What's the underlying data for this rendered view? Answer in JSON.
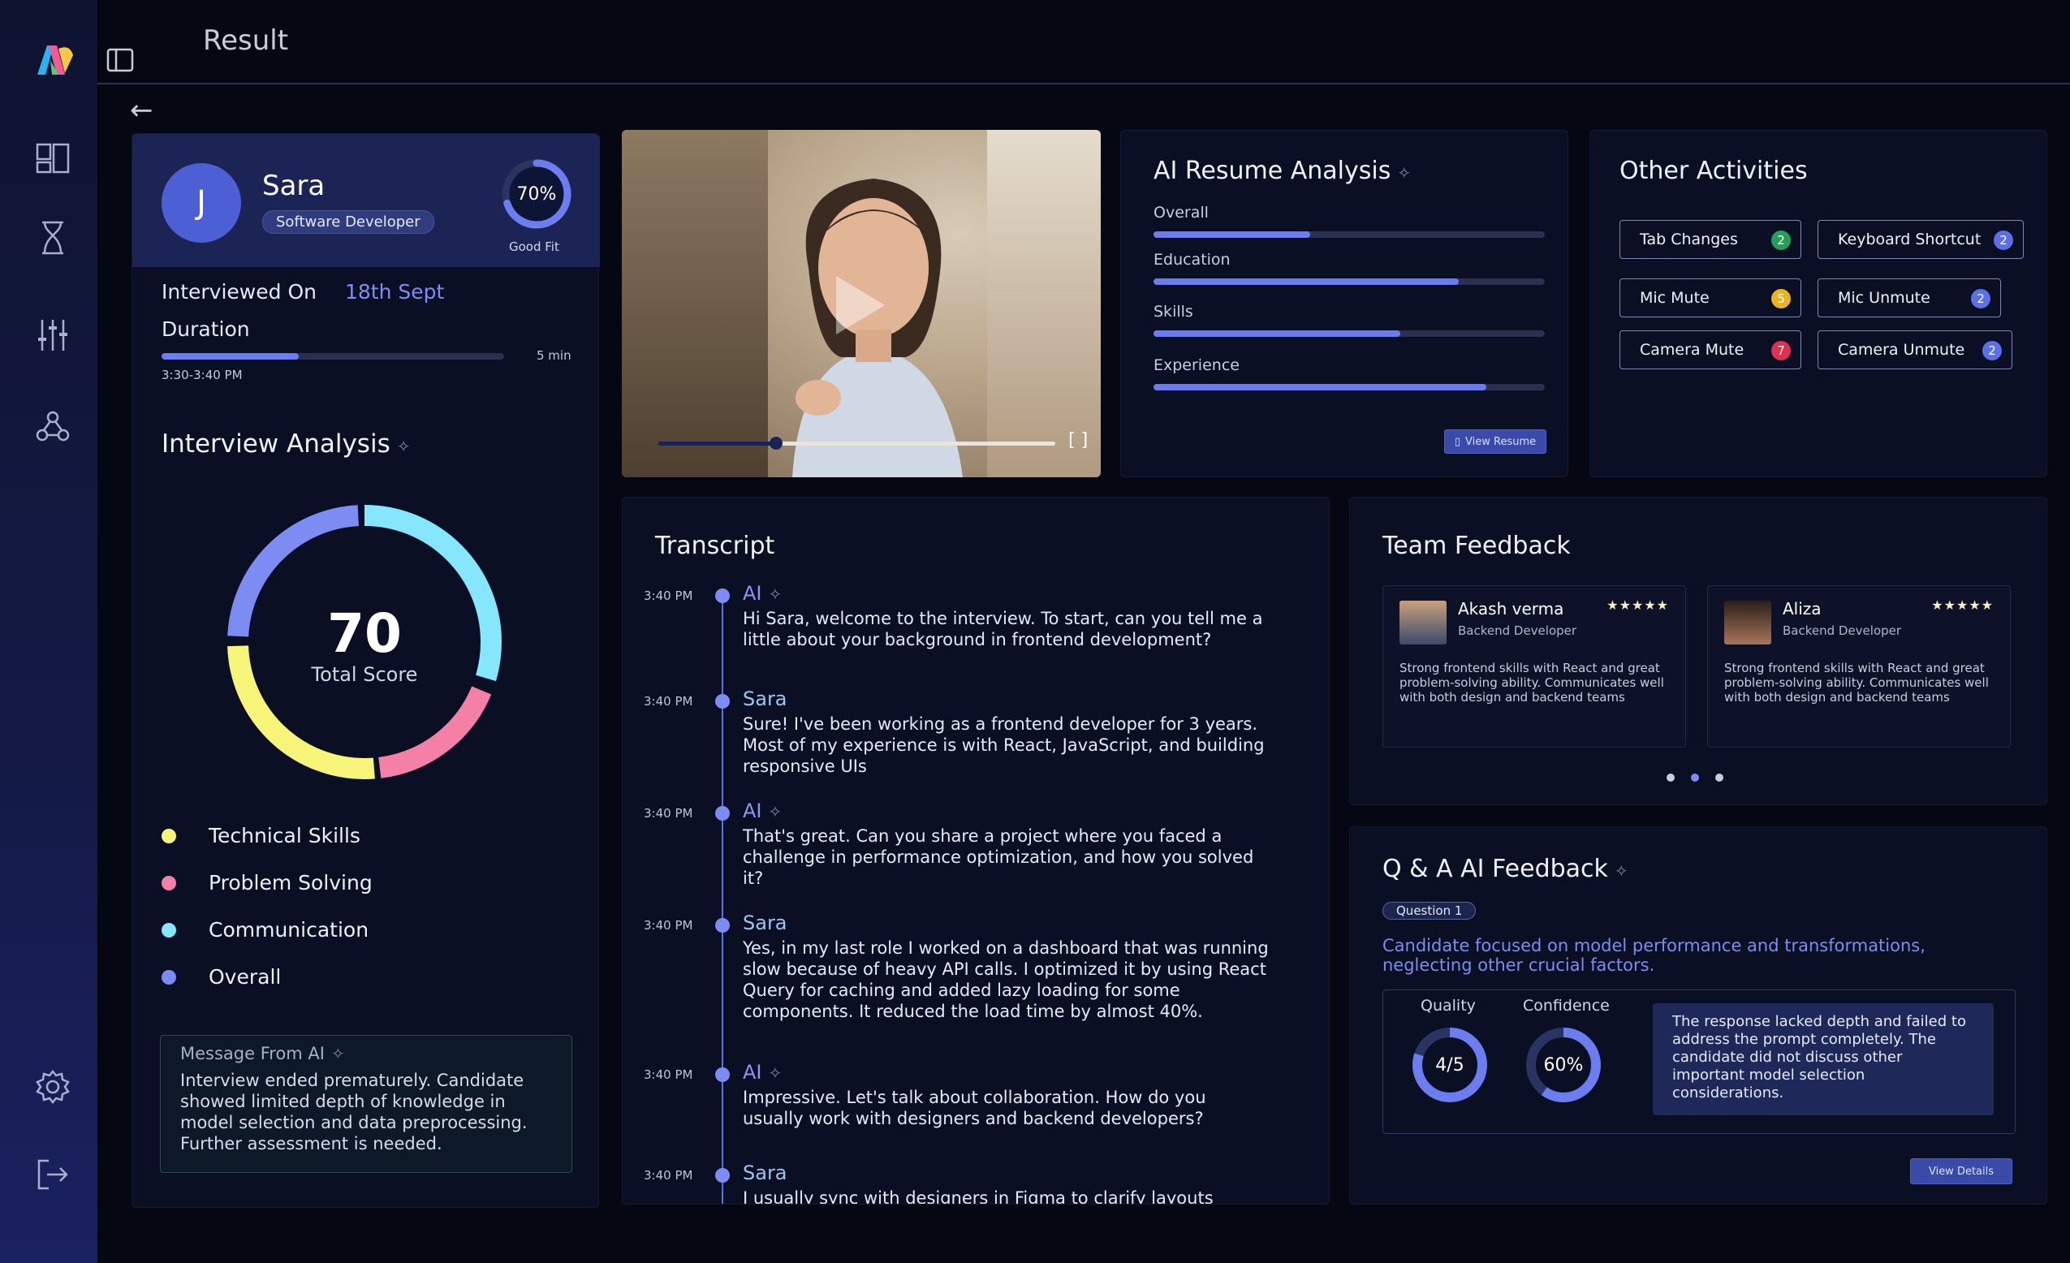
{
  "app": {
    "title": "Result"
  },
  "sidebar": {
    "items": [
      "dashboard-icon",
      "hourglass-icon",
      "sliders-icon",
      "webhook-icon",
      "settings-icon",
      "logout-icon"
    ]
  },
  "candidate": {
    "initial": "J",
    "name": "Sara",
    "role": "Software Developer",
    "fit_value": "70%",
    "fit_fraction": 0.7,
    "fit_label": "Good Fit",
    "interviewed_label": "Interviewed On",
    "interviewed_value": "18th Sept",
    "duration_label": "Duration",
    "duration_value": "5 min",
    "duration_fraction": 0.4,
    "time_range": "3:30-3:40 PM"
  },
  "interview_analysis": {
    "title": "Interview Analysis",
    "score": "70",
    "score_label": "Total Score",
    "legend": [
      "Technical Skills",
      "Problem Solving",
      "Communication",
      "Overall"
    ],
    "colors": {
      "technical": "#f7f47a",
      "problem": "#f480a8",
      "communication": "#86e6fb",
      "overall": "#7d8cf2"
    },
    "message_title": "Message From AI",
    "message": "Interview ended prematurely. Candidate showed limited depth of knowledge in model selection and data preprocessing. Further assessment is needed."
  },
  "resume": {
    "title": "AI Resume Analysis",
    "bars": [
      {
        "label": "Overall",
        "value": 0.4
      },
      {
        "label": "Education",
        "value": 0.78
      },
      {
        "label": "Skills",
        "value": 0.63
      },
      {
        "label": "Experience",
        "value": 0.85
      }
    ],
    "button": "View Resume"
  },
  "activities": {
    "title": "Other Activities",
    "items": [
      {
        "label": "Tab Changes",
        "count": "2",
        "color": "#22a05a"
      },
      {
        "label": "Keyboard Shortcut",
        "count": "2",
        "color": "#5b6fe8"
      },
      {
        "label": "Mic Mute",
        "count": "5",
        "color": "#e8b51c"
      },
      {
        "label": "Mic Unmute",
        "count": "2",
        "color": "#5b6fe8"
      },
      {
        "label": "Camera Mute",
        "count": "7",
        "color": "#e0304f"
      },
      {
        "label": "Camera Unmute",
        "count": "2",
        "color": "#5b6fe8"
      }
    ]
  },
  "transcript": {
    "title": "Transcript",
    "entries": [
      {
        "time": "3:40 PM",
        "speaker": "AI",
        "text": "Hi Sara, welcome to the interview. To start, can you tell me a little about your background in frontend development?"
      },
      {
        "time": "3:40 PM",
        "speaker": "Sara",
        "text": "Sure! I've been working as a frontend developer for 3 years. Most of my experience is with React, JavaScript, and building responsive UIs"
      },
      {
        "time": "3:40 PM",
        "speaker": "AI",
        "text": "That's great. Can you share a project where you faced a challenge in performance optimization, and how you solved it?"
      },
      {
        "time": "3:40 PM",
        "speaker": "Sara",
        "text": "Yes, in my last role I worked on a dashboard that was running slow because of heavy API calls. I optimized it by using React Query for caching and added lazy loading for some components. It reduced the load time by almost 40%."
      },
      {
        "time": "3:40 PM",
        "speaker": "AI",
        "text": "Impressive. Let's talk about collaboration. How do you usually work with designers and backend developers?"
      },
      {
        "time": "3:40 PM",
        "speaker": "Sara",
        "text": "I usually sync with designers in Figma to clarify layouts"
      }
    ]
  },
  "team": {
    "title": "Team Feedback",
    "cards": [
      {
        "name": "Akash verma",
        "role": "Backend Developer",
        "stars": "★★★★★",
        "text": "Strong frontend skills with React and great problem-solving ability. Communicates well with both design and backend teams"
      },
      {
        "name": "Aliza",
        "role": "Backend Developer",
        "stars": "★★★★★",
        "text": "Strong frontend skills with React and great problem-solving ability. Communicates well with both design and backend teams"
      }
    ]
  },
  "qa": {
    "title": "Q & A AI Feedback",
    "question": "Question 1",
    "summary": "Candidate focused on model performance and transformations, neglecting other crucial factors.",
    "quality_label": "Quality",
    "quality_value": "4/5",
    "quality_fraction": 0.8,
    "confidence_label": "Confidence",
    "confidence_value": "60%",
    "confidence_fraction": 0.6,
    "response": "The response lacked depth and failed to address the prompt completely. The candidate did not discuss other important model selection considerations.",
    "button": "View Details"
  }
}
